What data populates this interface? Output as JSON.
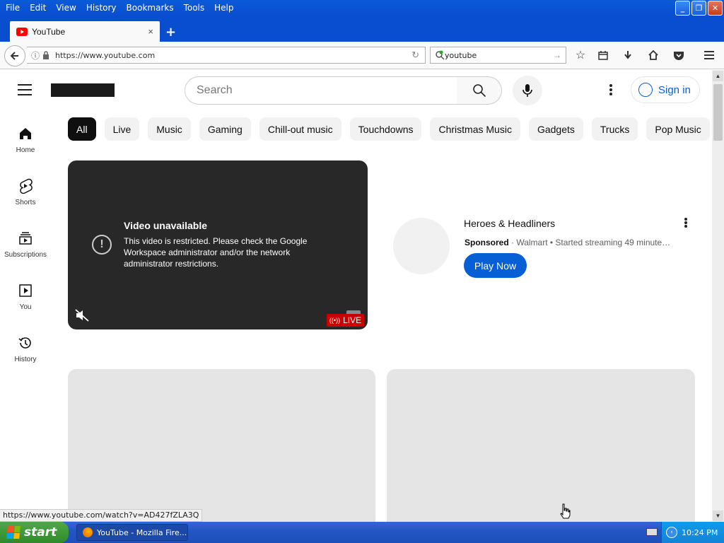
{
  "menu": [
    "File",
    "Edit",
    "View",
    "History",
    "Bookmarks",
    "Tools",
    "Help"
  ],
  "window_buttons": {
    "minimize": "_",
    "maximize": "❐",
    "close": "✕"
  },
  "browser": {
    "tab_title": "YouTube",
    "tab_close": "×",
    "new_tab": "+",
    "url": "https://www.youtube.com",
    "search_value": "youtube"
  },
  "yt": {
    "search_placeholder": "Search",
    "sign_in": "Sign in",
    "sidebar": [
      {
        "label": "Home"
      },
      {
        "label": "Shorts"
      },
      {
        "label": "Subscriptions"
      },
      {
        "label": "You"
      },
      {
        "label": "History"
      }
    ],
    "chips": [
      "All",
      "Live",
      "Music",
      "Gaming",
      "Chill-out music",
      "Touchdowns",
      "Christmas Music",
      "Gadgets",
      "Trucks",
      "Pop Music"
    ],
    "player": {
      "heading": "Video unavailable",
      "message": "This video is restricted. Please check the Google Workspace administrator and/or the network administrator restrictions.",
      "live": "LIVE"
    },
    "ad": {
      "title": "Heroes & Headliners",
      "sponsored": "Sponsored",
      "meta": " · Walmart • Started streaming 49 minute…",
      "cta": "Play Now"
    }
  },
  "status_url": "https://www.youtube.com/watch?v=AD427fZLA3Q",
  "taskbar": {
    "start": "start",
    "item": "YouTube - Mozilla Fire...",
    "clock": "10:24 PM"
  },
  "colors": {
    "accent": "#065fd4",
    "live": "#cc0000",
    "xp_blue": "#0a4ed0"
  }
}
